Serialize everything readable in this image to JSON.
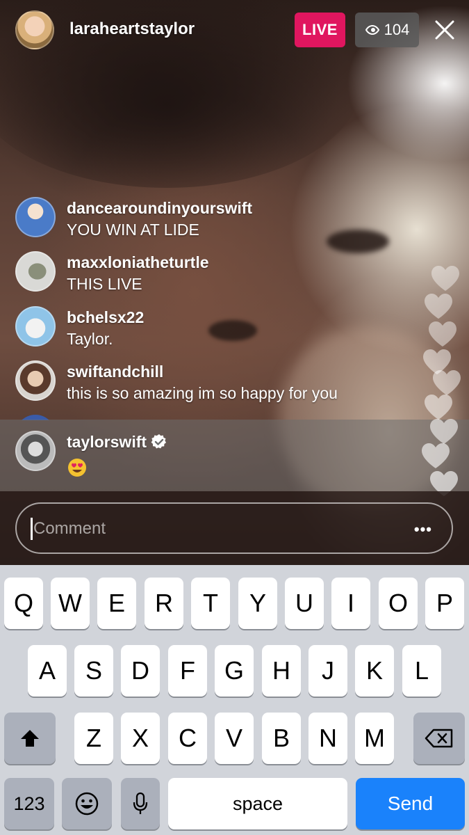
{
  "header": {
    "host_username": "laraheartstaylor",
    "live_label": "LIVE",
    "viewer_count": "104"
  },
  "comments": [
    {
      "user": "dancearoundinyourswift",
      "text": "YOU WIN AT LIDE"
    },
    {
      "user": "maxxloniatheturtle",
      "text": "THIS LIVE"
    },
    {
      "user": "bchelsx22",
      "text": "Taylor."
    },
    {
      "user": "swiftandchill",
      "text": "this is so amazing im so happy for you"
    }
  ],
  "pinned_comment": {
    "user": "taylorswift",
    "verified": true,
    "emoji": "heart-eyes-emoji"
  },
  "comment_bar": {
    "placeholder": "Comment",
    "more_label": "•••"
  },
  "keyboard": {
    "row1": [
      "Q",
      "W",
      "E",
      "R",
      "T",
      "Y",
      "U",
      "I",
      "O",
      "P"
    ],
    "row2": [
      "A",
      "S",
      "D",
      "F",
      "G",
      "H",
      "J",
      "K",
      "L"
    ],
    "row3": [
      "Z",
      "X",
      "C",
      "V",
      "B",
      "N",
      "M"
    ],
    "numbers_label": "123",
    "space_label": "space",
    "send_label": "Send"
  },
  "colors": {
    "live": "#e0165f",
    "send": "#1a82fb",
    "keyboard_bg": "#d1d4da"
  },
  "icons": [
    "eye-icon",
    "close-icon",
    "verified-badge-icon",
    "shift-icon",
    "backspace-icon",
    "emoji-icon",
    "microphone-icon",
    "heart-icon"
  ]
}
